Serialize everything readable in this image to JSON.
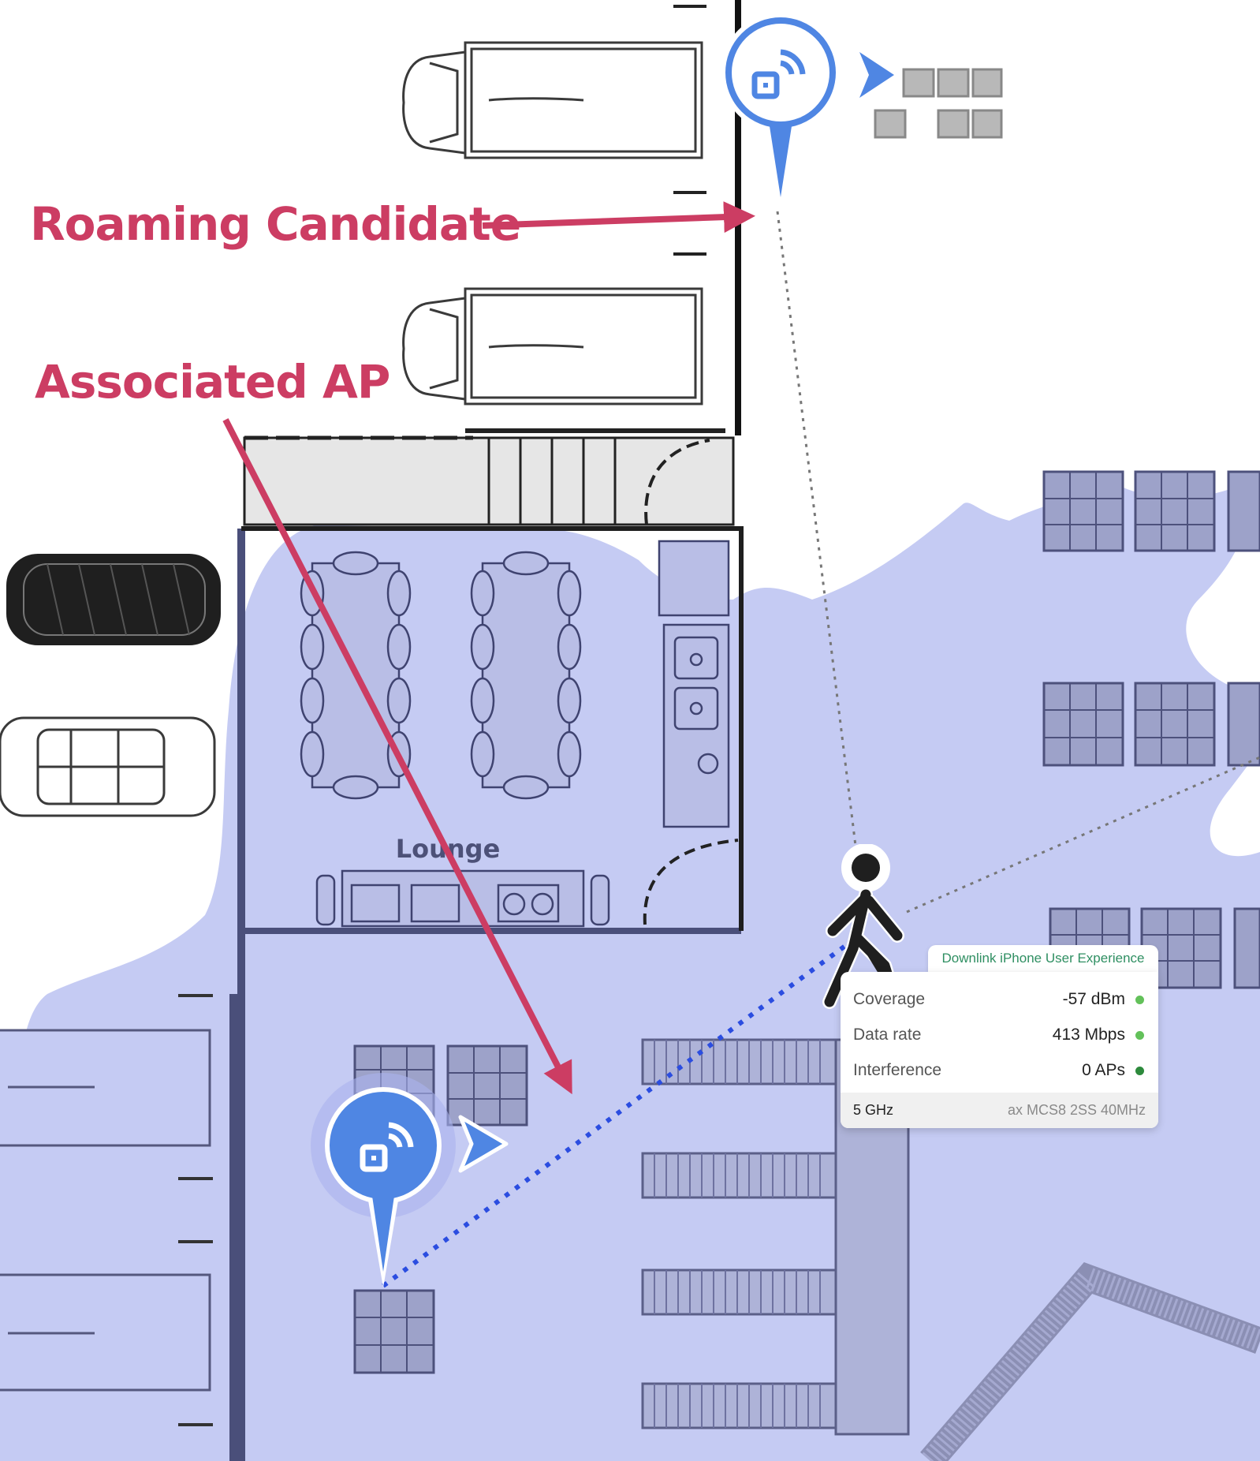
{
  "annotations": {
    "roaming_candidate": "Roaming Candidate",
    "associated_ap": "Associated AP"
  },
  "floor_plan": {
    "room_label": "Lounge"
  },
  "colors": {
    "coverage_fill": "#c5cbf3",
    "annotation_arrow": "#cc3d63",
    "ap_pin": "#4f86e3",
    "association_line": "#2b4de0",
    "status_good": "#63c15a",
    "status_ok": "#2d8a3c"
  },
  "icons": {
    "access_point": "access-point-icon",
    "client": "walking-person-icon",
    "direction": "direction-arrow-icon"
  },
  "tooltip": {
    "title": "Downlink iPhone User Experience",
    "rows": [
      {
        "label": "Coverage",
        "value": "-57 dBm",
        "status_color": "#63c15a"
      },
      {
        "label": "Data rate",
        "value": "413 Mbps",
        "status_color": "#63c15a"
      },
      {
        "label": "Interference",
        "value": "0 APs",
        "status_color": "#2d8a3c"
      }
    ],
    "band": "5 GHz",
    "spec": "ax MCS8 2SS 40MHz"
  }
}
